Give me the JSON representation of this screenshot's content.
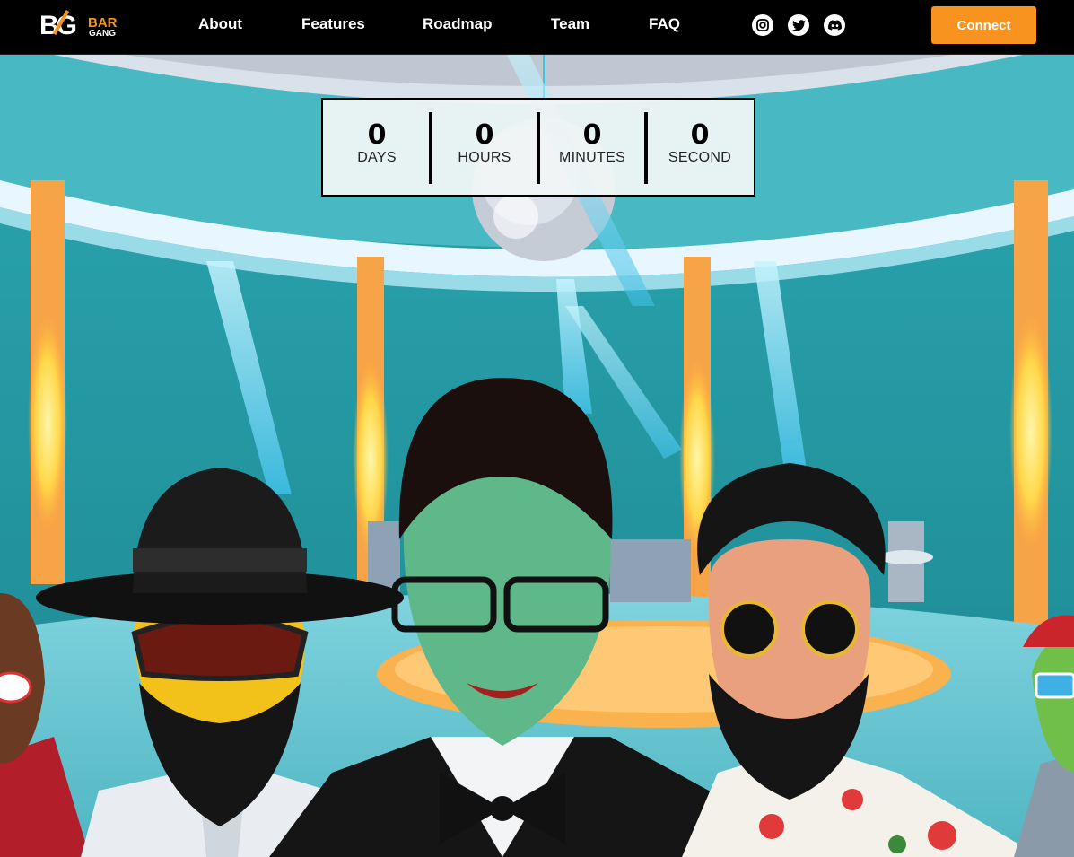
{
  "brand": {
    "mark": "BG",
    "bar": "BAR",
    "gang": "GANG",
    "accent_color": "#f7931e"
  },
  "nav": {
    "links": [
      {
        "label": "About"
      },
      {
        "label": "Features"
      },
      {
        "label": "Roadmap"
      },
      {
        "label": "Team"
      },
      {
        "label": "FAQ"
      }
    ],
    "social": [
      {
        "icon": "instagram-icon"
      },
      {
        "icon": "twitter-icon"
      },
      {
        "icon": "discord-icon"
      }
    ],
    "connect_label": "Connect"
  },
  "countdown": {
    "days": {
      "value": "0",
      "label": "DAYS"
    },
    "hours": {
      "value": "0",
      "label": "HOURS"
    },
    "minutes": {
      "value": "0",
      "label": "MINUTES"
    },
    "seconds": {
      "value": "0",
      "label": "SECOND"
    }
  },
  "hero": {
    "scene": "nightclub-illustration",
    "characters": [
      "character-red-suit",
      "character-black-hat",
      "character-green-face",
      "character-bearded-floral",
      "character-green-cap"
    ]
  }
}
